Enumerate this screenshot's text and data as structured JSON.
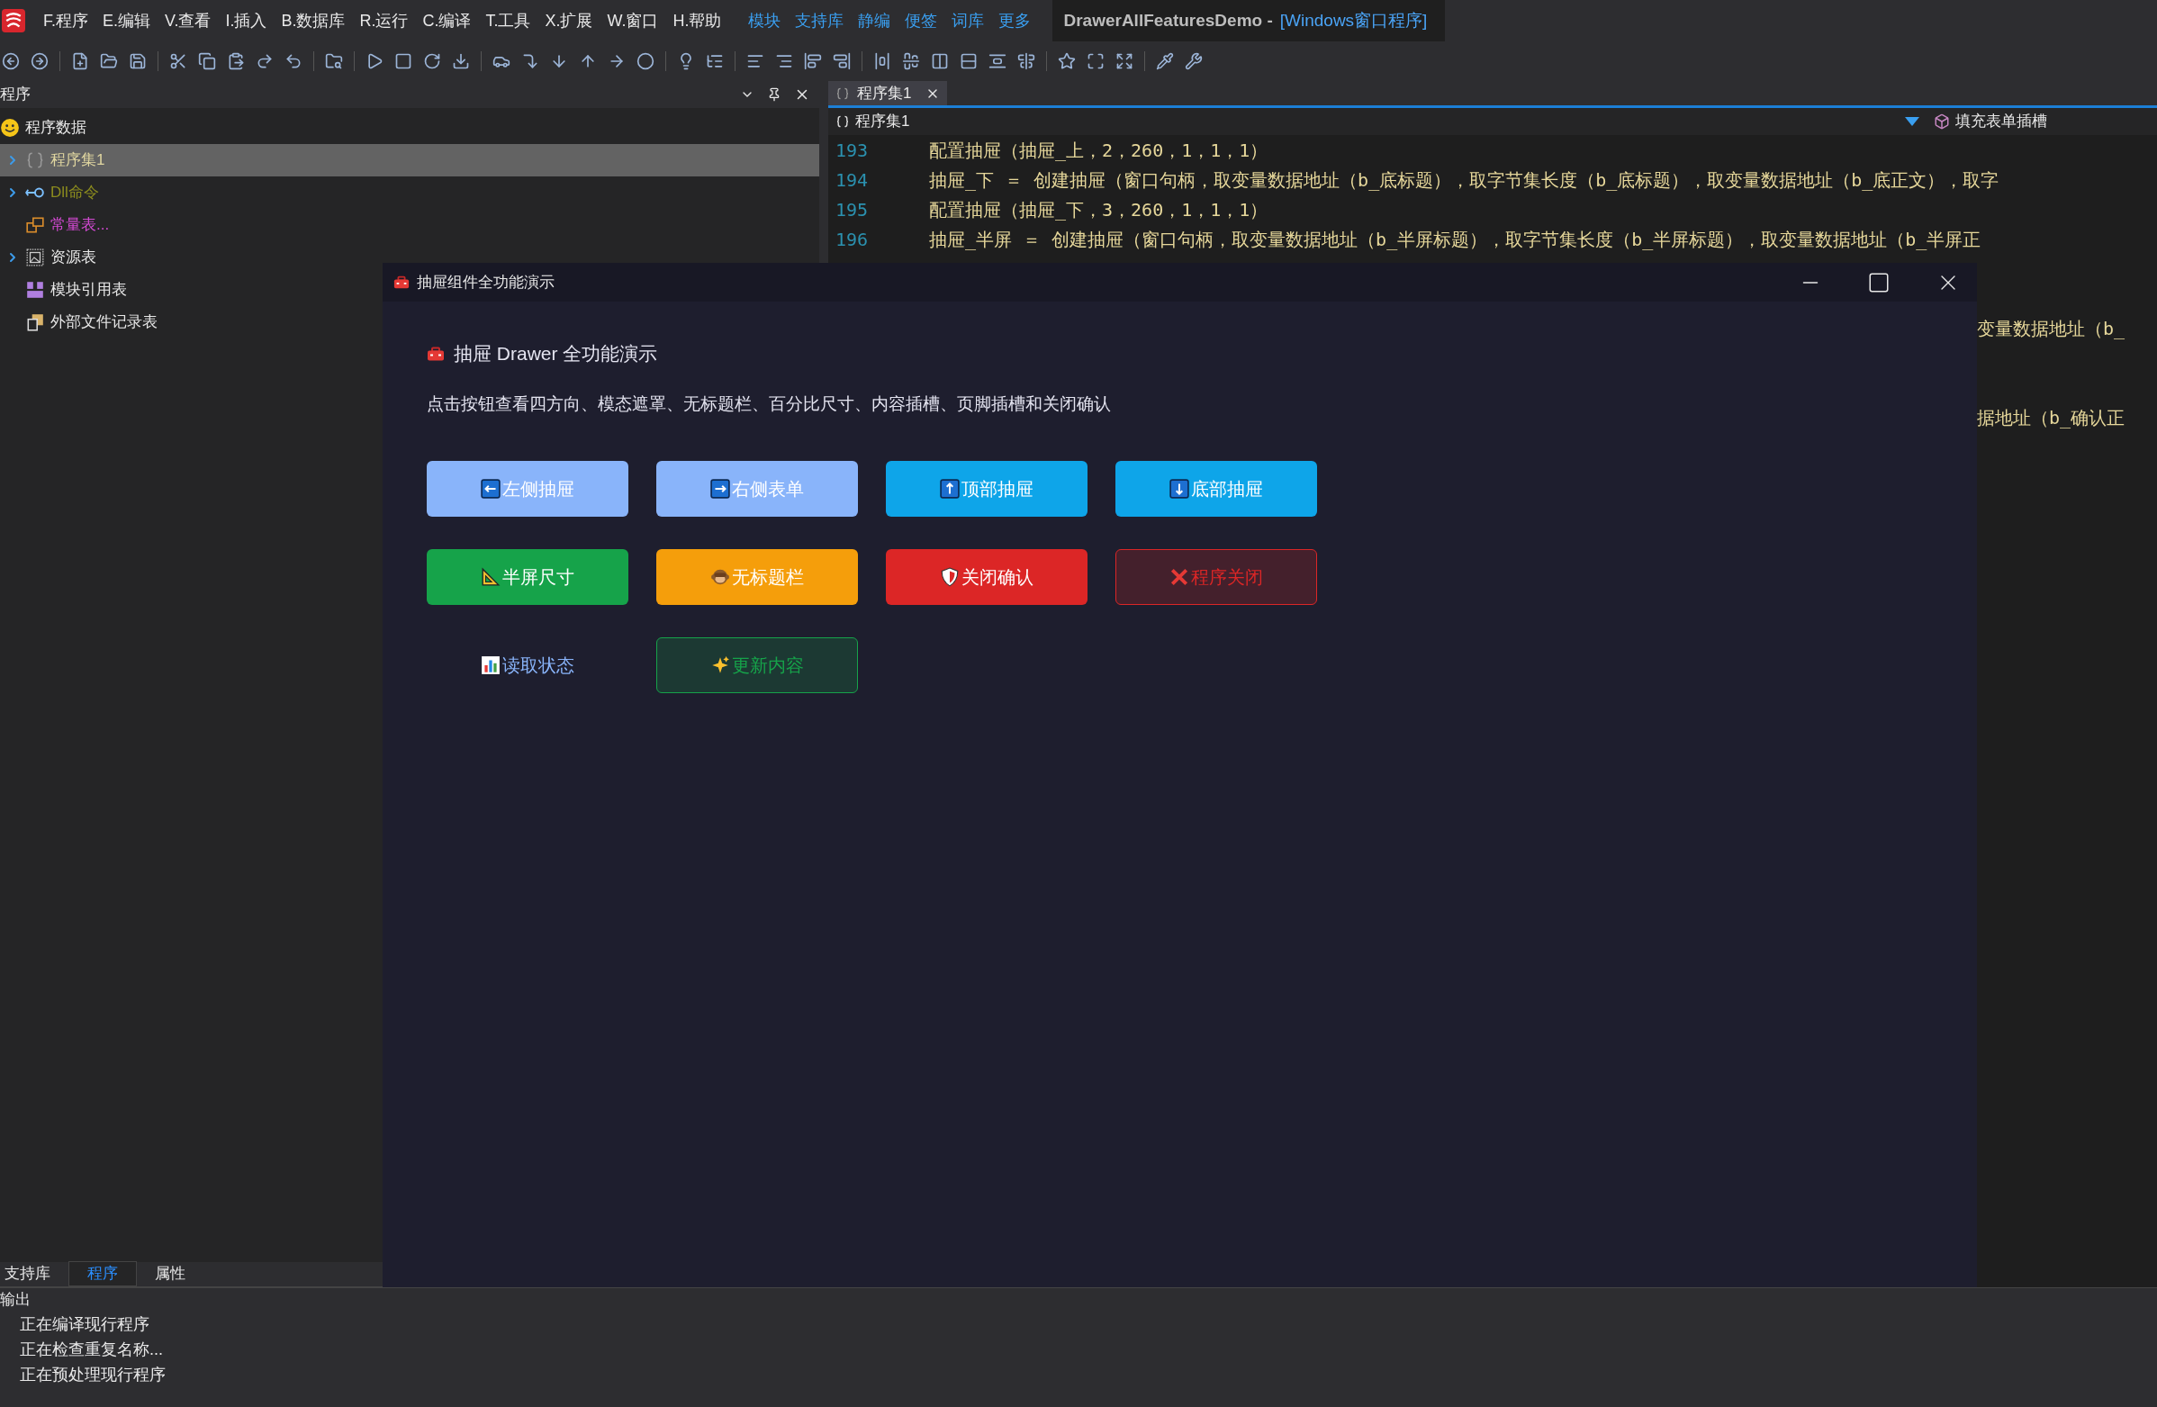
{
  "menu_bar": {
    "items": [
      "F.程序",
      "E.编辑",
      "V.查看",
      "I.插入",
      "B.数据库",
      "R.运行",
      "C.编译",
      "T.工具",
      "X.扩展",
      "W.窗口",
      "H.帮助"
    ],
    "links": [
      "模块",
      "支持库",
      "静编",
      "便签",
      "词库",
      "更多"
    ],
    "title": "DrawerAllFeaturesDemo -",
    "title_suffix": "[Windows窗口程序]"
  },
  "left_panel": {
    "title": "程序",
    "tree": [
      {
        "label": "程序数据",
        "selected": false,
        "color": "#e8e8e8",
        "children": [
          {
            "label": "程序集1",
            "expandable": true,
            "selected": true,
            "color": "#e0d6a0"
          },
          {
            "label": "Dll命令",
            "expandable": true,
            "selected": false,
            "color": "#8c8c1e"
          },
          {
            "label": "常量表...",
            "expandable": false,
            "selected": false,
            "color": "#d54ad5"
          },
          {
            "label": "资源表",
            "expandable": true,
            "selected": false,
            "color": "#e8e8e8"
          },
          {
            "label": "模块引用表",
            "expandable": false,
            "selected": false,
            "color": "#e8e8e8"
          },
          {
            "label": "外部文件记录表",
            "expandable": false,
            "selected": false,
            "color": "#e8e8e8"
          }
        ]
      }
    ],
    "tabs": [
      {
        "label": "支持库",
        "selected": false
      },
      {
        "label": "程序",
        "selected": true
      },
      {
        "label": "属性",
        "selected": false
      }
    ]
  },
  "editor": {
    "tab": "程序集1",
    "nav_left": "程序集1",
    "nav_right": "填充表单插槽",
    "lines": [
      {
        "number": "193",
        "text": "配置抽屉（抽屉_上，2，260，1，1，1）"
      },
      {
        "number": "194",
        "text": "抽屉_下 ＝ 创建抽屉（窗口句柄，取变量数据地址（b_底标题），取字节集长度（b_底标题），取变量数据地址（b_底正文），取字"
      },
      {
        "number": "195",
        "text": "配置抽屉（抽屉_下，3，260，1，1，1）"
      },
      {
        "number": "196",
        "text": "抽屉_半屏 ＝ 创建抽屉（窗口句柄，取变量数据地址（b_半屏标题），取字节集长度（b_半屏标题），取变量数据地址（b_半屏正"
      }
    ],
    "fragments": [
      "变量数据地址（b_",
      "据地址（b_确认正"
    ]
  },
  "dialog": {
    "title": "抽屉组件全功能演示",
    "heading": "抽屉 Drawer 全功能演示",
    "description": "点击按钮查看四方向、模态遮罩、无标题栏、百分比尺寸、内容插槽、页脚插槽和关闭确认",
    "buttons": [
      {
        "label": "左侧抽屉",
        "kind": "solid",
        "color": "#89b4fa"
      },
      {
        "label": "右侧表单",
        "kind": "solid",
        "color": "#89b4fa"
      },
      {
        "label": "顶部抽屉",
        "kind": "solid",
        "color": "#0ea5e9"
      },
      {
        "label": "底部抽屉",
        "kind": "solid",
        "color": "#0ea5e9"
      },
      {
        "label": "半屏尺寸",
        "kind": "solid",
        "color": "#16a34a"
      },
      {
        "label": "无标题栏",
        "kind": "solid",
        "color": "#f59e0b"
      },
      {
        "label": "关闭确认",
        "kind": "solid",
        "color": "#dc2626"
      },
      {
        "label": "程序关闭",
        "kind": "outline",
        "color": "#dc2626"
      },
      {
        "label": "读取状态",
        "kind": "link",
        "color": "#89b4fa"
      },
      {
        "label": "更新内容",
        "kind": "outline",
        "color": "#16a34a"
      }
    ]
  },
  "output": {
    "title": "输出",
    "lines": [
      "正在编译现行程序",
      "正在检查重复名称...",
      "正在预处理现行程序"
    ]
  }
}
